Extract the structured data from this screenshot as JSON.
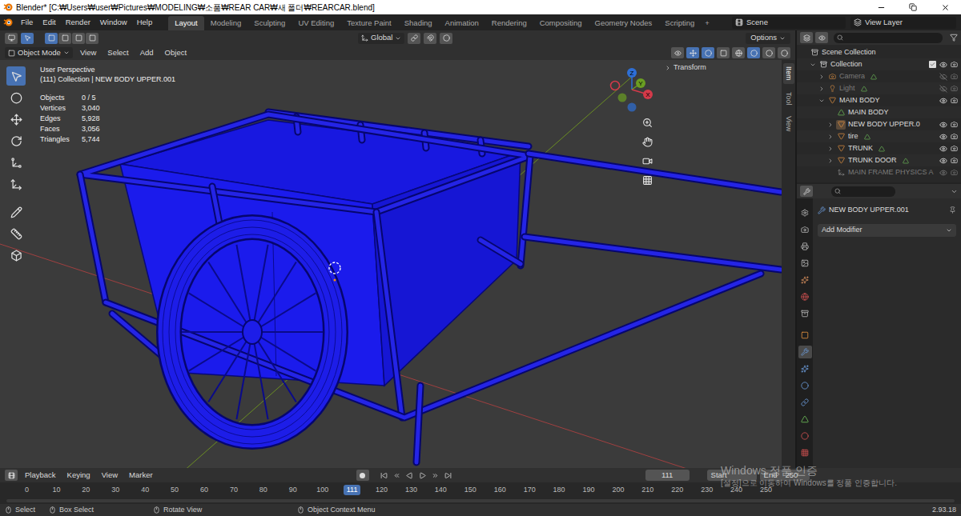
{
  "window": {
    "title": "Blender* [C:₩Users₩user₩Pictures₩MODELING₩소품₩REAR CAR₩새 폴더₩REARCAR.blend]"
  },
  "menu": [
    "File",
    "Edit",
    "Render",
    "Window",
    "Help"
  ],
  "workspaces": [
    {
      "label": "Layout",
      "selected": true
    },
    {
      "label": "Modeling",
      "selected": false
    },
    {
      "label": "Sculpting",
      "selected": false
    },
    {
      "label": "UV Editing",
      "selected": false
    },
    {
      "label": "Texture Paint",
      "selected": false
    },
    {
      "label": "Shading",
      "selected": false
    },
    {
      "label": "Animation",
      "selected": false
    },
    {
      "label": "Rendering",
      "selected": false
    },
    {
      "label": "Compositing",
      "selected": false
    },
    {
      "label": "Geometry Nodes",
      "selected": false
    },
    {
      "label": "Scripting",
      "selected": false
    }
  ],
  "add_workspace": "+",
  "scene": "Scene",
  "view_layer": "View Layer",
  "viewport_header": {
    "orientation": "Global",
    "options": "Options",
    "mode": "Object Mode",
    "menus": [
      "View",
      "Select",
      "Add",
      "Object"
    ]
  },
  "toolbar": [
    {
      "selected": true
    },
    {
      "selected": false
    },
    {
      "selected": false
    },
    {
      "selected": false
    },
    {
      "selected": false
    },
    {
      "selected": false
    },
    {
      "selected": false
    },
    {
      "selected": false
    },
    {
      "selected": false
    }
  ],
  "viewport": {
    "perspective": "User Perspective",
    "context": "(111) Collection | NEW BODY UPPER.001",
    "stats": [
      {
        "label": "Objects",
        "value": "0 / 5"
      },
      {
        "label": "Vertices",
        "value": "3,040"
      },
      {
        "label": "Edges",
        "value": "5,928"
      },
      {
        "label": "Faces",
        "value": "3,056"
      },
      {
        "label": "Triangles",
        "value": "5,744"
      }
    ],
    "transform_panel": "Transform",
    "gizmo": {
      "x": "X",
      "y": "Y",
      "z": "Z"
    },
    "side_tabs": [
      {
        "label": "Item",
        "selected": true
      },
      {
        "label": "Tool",
        "selected": false
      },
      {
        "label": "View",
        "selected": false
      }
    ]
  },
  "outliner": {
    "rows": [
      {
        "name": "Scene Collection",
        "depth": 0,
        "kind": "scene",
        "expandable": false,
        "expanded": false,
        "visible": true,
        "dim": false,
        "active": false,
        "data_icon": false
      },
      {
        "name": "Collection",
        "depth": 1,
        "kind": "collection",
        "expandable": true,
        "expanded": true,
        "visible": true,
        "dim": false,
        "active": false,
        "data_icon": false
      },
      {
        "name": "Camera",
        "depth": 2,
        "kind": "camera",
        "expandable": true,
        "expanded": false,
        "visible": false,
        "dim": true,
        "active": false,
        "data_icon": true
      },
      {
        "name": "Light",
        "depth": 2,
        "kind": "light",
        "expandable": true,
        "expanded": false,
        "visible": false,
        "dim": true,
        "active": false,
        "data_icon": true
      },
      {
        "name": "MAIN BODY",
        "depth": 2,
        "kind": "object",
        "expandable": true,
        "expanded": true,
        "visible": true,
        "dim": false,
        "active": false,
        "data_icon": false
      },
      {
        "name": "MAIN BODY",
        "depth": 3,
        "kind": "mesh",
        "expandable": false,
        "expanded": false,
        "visible": true,
        "dim": false,
        "active": false,
        "data_icon": false
      },
      {
        "name": "NEW BODY UPPER.0",
        "depth": 3,
        "kind": "object",
        "expandable": true,
        "expanded": false,
        "visible": true,
        "dim": false,
        "active": true,
        "data_icon": false
      },
      {
        "name": "tire",
        "depth": 3,
        "kind": "object",
        "expandable": true,
        "expanded": false,
        "visible": true,
        "dim": false,
        "active": false,
        "data_icon": true
      },
      {
        "name": "TRUNK",
        "depth": 3,
        "kind": "object",
        "expandable": true,
        "expanded": false,
        "visible": true,
        "dim": false,
        "active": false,
        "data_icon": true
      },
      {
        "name": "TRUNK DOOR",
        "depth": 3,
        "kind": "object",
        "expandable": true,
        "expanded": false,
        "visible": true,
        "dim": false,
        "active": false,
        "data_icon": true
      },
      {
        "name": "MAIN FRAME PHYSICS A",
        "depth": 3,
        "kind": "armature",
        "expandable": false,
        "expanded": false,
        "visible": true,
        "dim": true,
        "active": false,
        "data_icon": false
      }
    ]
  },
  "properties": {
    "object_name": "NEW BODY UPPER.001",
    "add_modifier": "Add Modifier",
    "tabs": [
      {
        "selected": false
      },
      {
        "selected": false
      },
      {
        "selected": false
      },
      {
        "selected": false
      },
      {
        "selected": false
      },
      {
        "selected": false
      },
      {
        "selected": false
      },
      {
        "selected": false
      },
      {
        "selected": true
      },
      {
        "selected": false
      },
      {
        "selected": false
      },
      {
        "selected": false
      },
      {
        "selected": false
      },
      {
        "selected": false
      },
      {
        "selected": false
      }
    ]
  },
  "timeline": {
    "menus": [
      "Playback",
      "Keying",
      "View",
      "Marker"
    ],
    "current_frame": "111",
    "start_label": "Start",
    "end_label": "End",
    "end_value": "250",
    "ruler": [
      {
        "label": "0",
        "selected": false
      },
      {
        "label": "10",
        "selected": false
      },
      {
        "label": "20",
        "selected": false
      },
      {
        "label": "30",
        "selected": false
      },
      {
        "label": "40",
        "selected": false
      },
      {
        "label": "50",
        "selected": false
      },
      {
        "label": "60",
        "selected": false
      },
      {
        "label": "70",
        "selected": false
      },
      {
        "label": "80",
        "selected": false
      },
      {
        "label": "90",
        "selected": false
      },
      {
        "label": "100",
        "selected": false
      },
      {
        "label": "111",
        "selected": true
      },
      {
        "label": "120",
        "selected": false
      },
      {
        "label": "130",
        "selected": false
      },
      {
        "label": "140",
        "selected": false
      },
      {
        "label": "150",
        "selected": false
      },
      {
        "label": "160",
        "selected": false
      },
      {
        "label": "170",
        "selected": false
      },
      {
        "label": "180",
        "selected": false
      },
      {
        "label": "190",
        "selected": false
      },
      {
        "label": "200",
        "selected": false
      },
      {
        "label": "210",
        "selected": false
      },
      {
        "label": "220",
        "selected": false
      },
      {
        "label": "230",
        "selected": false
      },
      {
        "label": "240",
        "selected": false
      },
      {
        "label": "250",
        "selected": false
      }
    ]
  },
  "status_bar": {
    "items": [
      "Select",
      "Box Select",
      "Rotate View",
      "Object Context Menu"
    ],
    "version": "2.93.18"
  },
  "watermark": {
    "title": "Windows 정품 인증",
    "subtitle": "[설정]으로 이동하여 Windows를 정품 인증합니다."
  }
}
